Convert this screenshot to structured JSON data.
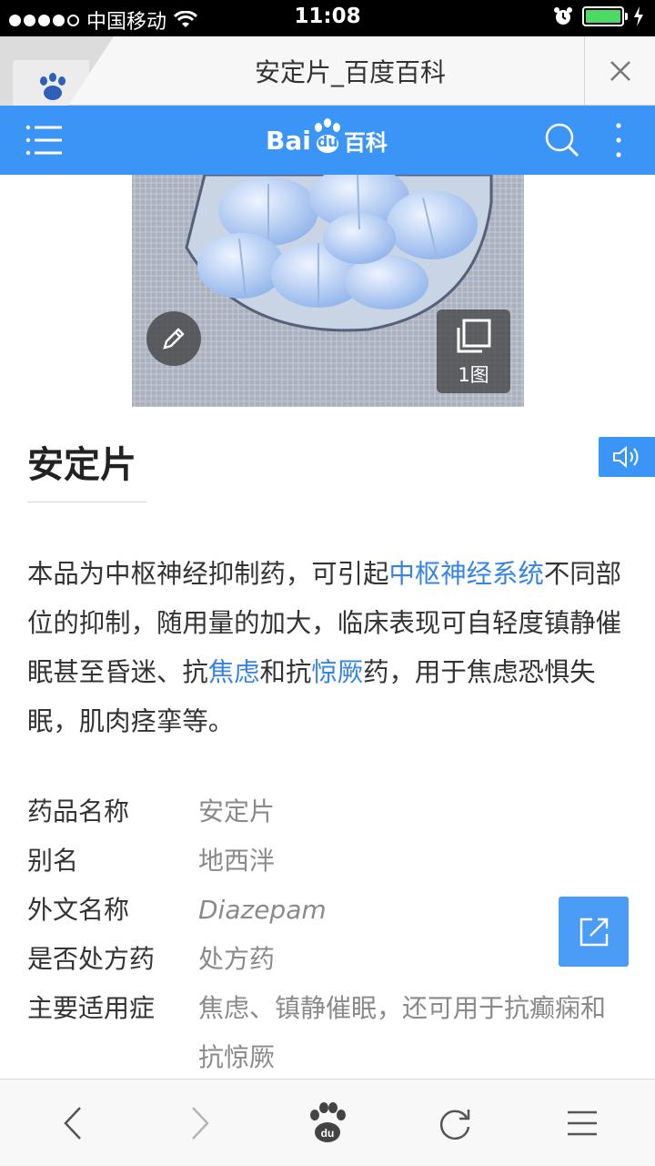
{
  "status": {
    "carrier": "中国移动",
    "time": "11:08"
  },
  "tab": {
    "title": "安定片_百度百科"
  },
  "header": {
    "logo_text_bai": "Bai",
    "logo_text_du": "du",
    "logo_text_baike": "百科"
  },
  "hero": {
    "image_count_label": "1图"
  },
  "article": {
    "title": "安定片",
    "summary": {
      "p1": "本品为中枢神经抑制药，可引起",
      "link1": "中枢神经系统",
      "p2": "不同部位的抑制，随用量的加大，临床表现可自轻度镇静催眠甚至昏迷、抗",
      "link2": "焦虑",
      "p3": "和抗",
      "link3": "惊厥",
      "p4": "药，用于焦虑恐惧失眠，肌肉痉挛等。"
    },
    "info": [
      {
        "key": "药品名称",
        "value": "安定片"
      },
      {
        "key": "别名",
        "value": "地西泮"
      },
      {
        "key": "外文名称",
        "value": "Diazepam"
      },
      {
        "key": "是否处方药",
        "value": "处方药"
      },
      {
        "key": "主要适用症",
        "value": "焦虑、镇静催眠，还可用于抗癫痫和抗惊厥"
      }
    ]
  },
  "colors": {
    "brand_blue": "#3b95f7",
    "link_blue": "#3584e4",
    "battery_green": "#4cd964"
  }
}
